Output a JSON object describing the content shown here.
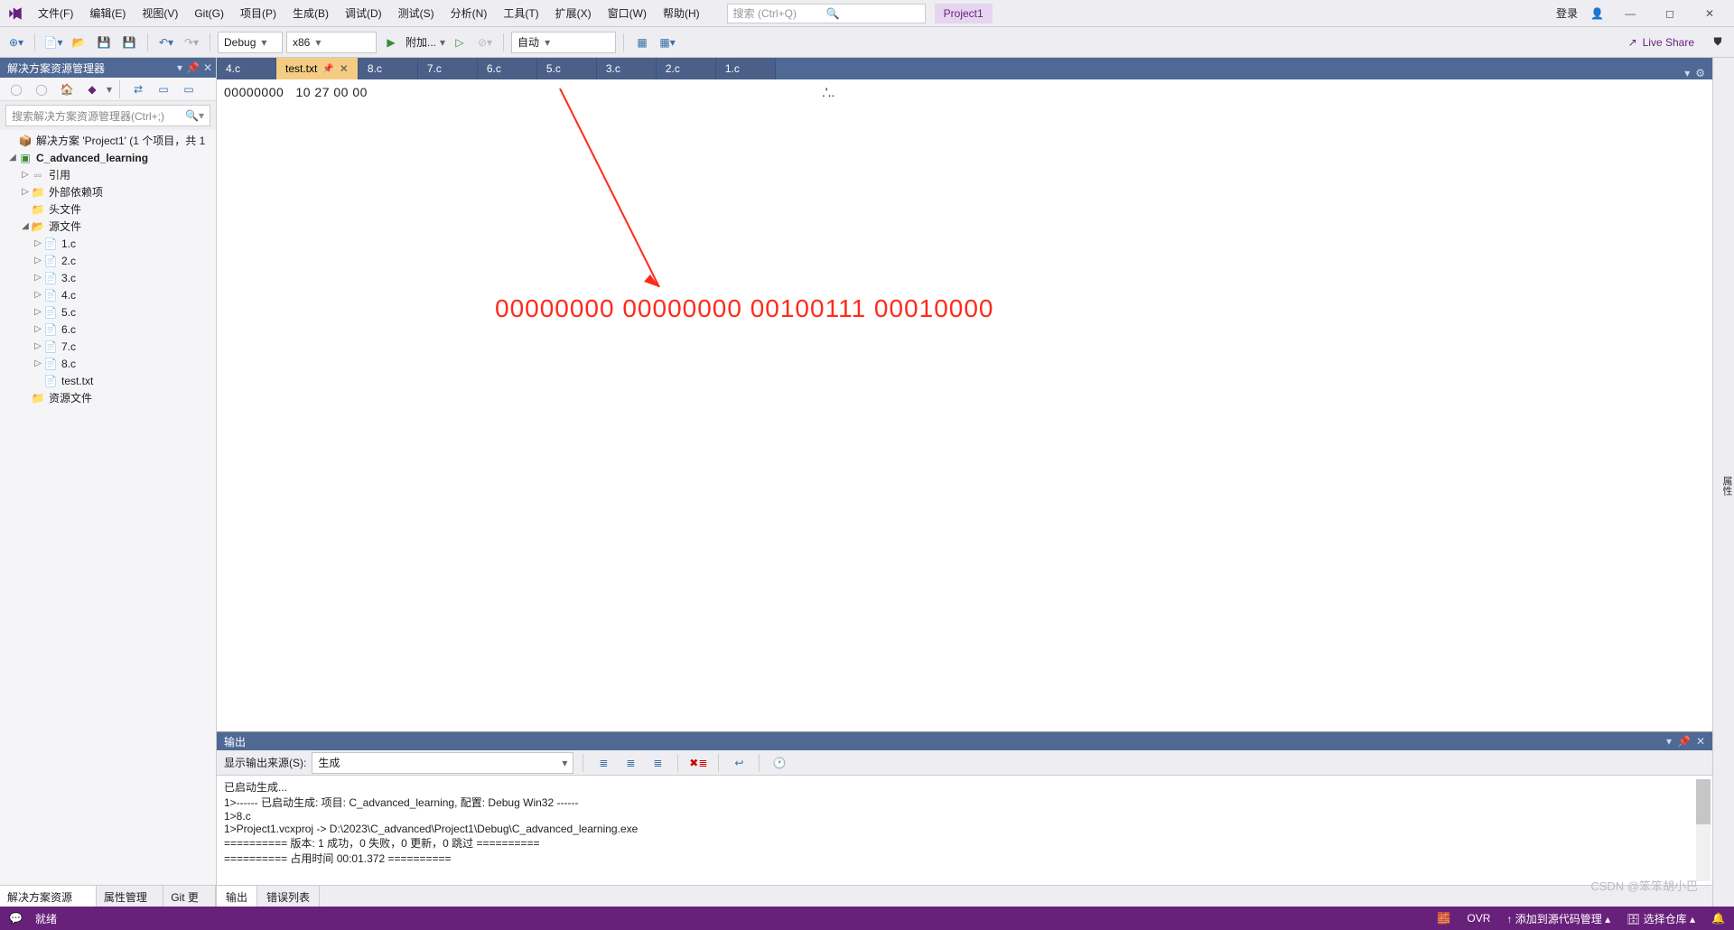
{
  "menu": [
    "文件(F)",
    "编辑(E)",
    "视图(V)",
    "Git(G)",
    "项目(P)",
    "生成(B)",
    "调试(D)",
    "测试(S)",
    "分析(N)",
    "工具(T)",
    "扩展(X)",
    "窗口(W)",
    "帮助(H)"
  ],
  "search": {
    "placeholder": "搜索 (Ctrl+Q)"
  },
  "project_badge": "Project1",
  "login": "登录",
  "toolbar": {
    "config": "Debug",
    "platform": "x86",
    "attach": "附加...",
    "auto": "自动"
  },
  "live_share": "Live Share",
  "sln_panel": {
    "title": "解决方案资源管理器",
    "search": "搜索解决方案资源管理器(Ctrl+;)"
  },
  "tree": {
    "solution": "解决方案 'Project1' (1 个项目，共 1",
    "project": "C_advanced_learning",
    "refs": "引用",
    "ext_deps": "外部依赖项",
    "headers": "头文件",
    "sources": "源文件",
    "files": [
      "1.c",
      "2.c",
      "3.c",
      "4.c",
      "5.c",
      "6.c",
      "7.c",
      "8.c",
      "test.txt"
    ],
    "res": "资源文件"
  },
  "side_tabs": [
    "解决方案资源管...",
    "属性管理器",
    "Git 更改"
  ],
  "doc_tabs": [
    "4.c",
    "test.txt",
    "8.c",
    "7.c",
    "6.c",
    "5.c",
    "3.c",
    "2.c",
    "1.c"
  ],
  "active_tab": "test.txt",
  "editor": {
    "offset": "00000000",
    "bytes": "10 27 00 00",
    "ascii": ".'..",
    "annotation": "00000000 00000000 00100111 00010000"
  },
  "output": {
    "title": "输出",
    "from_label": "显示输出来源(S):",
    "from_value": "生成",
    "lines": [
      "已启动生成...",
      "1>------ 已启动生成: 项目: C_advanced_learning, 配置: Debug Win32 ------",
      "1>8.c",
      "1>Project1.vcxproj -> D:\\2023\\C_advanced\\Project1\\Debug\\C_advanced_learning.exe",
      "========== 版本: 1 成功，0 失败，0 更新，0 跳过 ==========",
      "========== 占用时间 00:01.372 =========="
    ]
  },
  "bottom_tabs": [
    "输出",
    "错误列表"
  ],
  "rail": "属性",
  "status": {
    "ready": "就绪",
    "ovr": "OVR",
    "add_src": "添加到源代码管理",
    "select_repo": "选择仓库"
  },
  "watermark": "CSDN @笨笨胡小巴"
}
